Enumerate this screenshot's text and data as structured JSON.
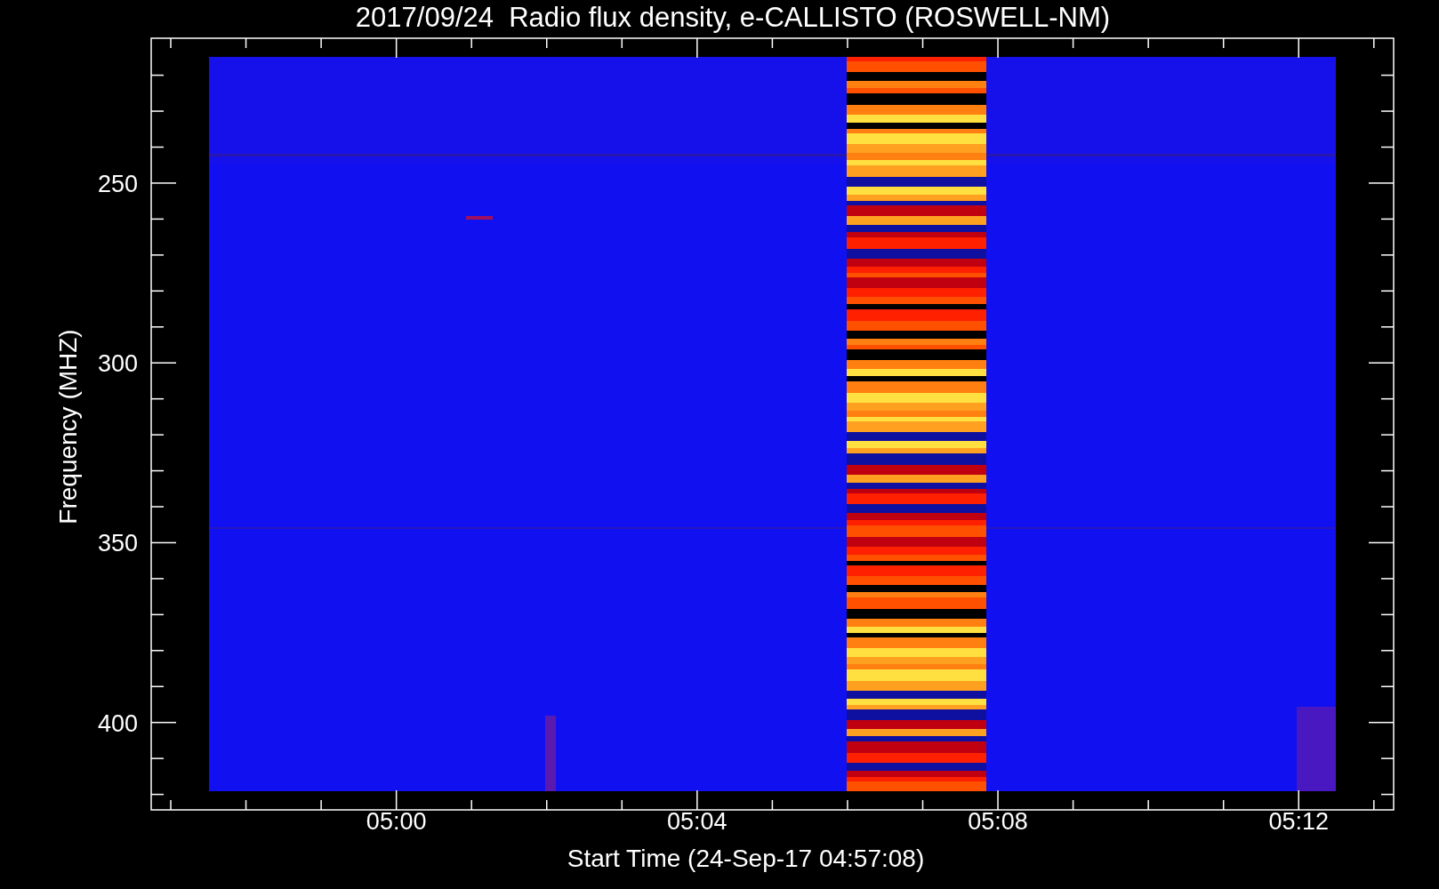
{
  "title": "2017/09/24  Radio flux density, e-CALLISTO (ROSWELL-NM)",
  "y_axis": {
    "label": "Frequency (MHZ)",
    "ticks": [
      "250",
      "300",
      "350",
      "400"
    ]
  },
  "x_axis": {
    "label": "Start Time (24-Sep-17 04:57:08)",
    "ticks": [
      "05:00",
      "05:04",
      "05:08",
      "05:12"
    ]
  }
}
